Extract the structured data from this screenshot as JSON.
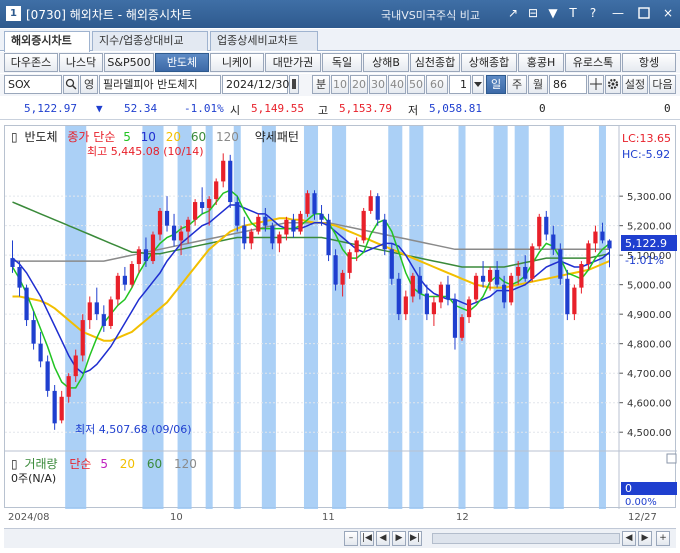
{
  "titlebar": {
    "app_number": "1",
    "title": "[0730] 해외차트 - 해외증시차트",
    "compare_label": "국내VS미국주식 비교",
    "buttons": [
      "↗",
      "⊟",
      "▼",
      "T",
      "?",
      "—",
      "×"
    ]
  },
  "tabs": [
    "해외증시차트",
    "지수/업종상대비교",
    "업종상세비교차트"
  ],
  "market_buttons": [
    {
      "label": "다우존스"
    },
    {
      "label": "나스닥"
    },
    {
      "label": "S&P500"
    },
    {
      "label": "반도체",
      "active": true
    },
    {
      "label": "니케이"
    },
    {
      "label": "대만가권"
    },
    {
      "label": "독일"
    },
    {
      "label": "상해B"
    },
    {
      "label": "심천종합"
    },
    {
      "label": "상해종합"
    },
    {
      "label": "홍콩H"
    },
    {
      "label": "유로스톡"
    },
    {
      "label": "항셍"
    }
  ],
  "controls": {
    "symbol": "SOX",
    "type_label": "영",
    "name": "필라델피아 반도체지",
    "date": "2024/12/30",
    "unit_button": "분",
    "intervals": [
      "10",
      "20",
      "30",
      "40",
      "50",
      "60"
    ],
    "count_value": "1",
    "periods": [
      {
        "label": "일",
        "active": true
      },
      {
        "label": "주"
      },
      {
        "label": "월"
      }
    ],
    "bars": "86",
    "settings_label": "설정",
    "next_label": "다음"
  },
  "quote": {
    "price": "5,122.97",
    "change_arrow": "▼",
    "change": "52.34",
    "change_pct": "-1.01%",
    "open_label": "시",
    "open": "5,149.55",
    "high_label": "고",
    "high": "5,153.79",
    "low_label": "저",
    "low": "5,058.81",
    "volume": "0",
    "amount": "0"
  },
  "colors": {
    "up": "#e8202a",
    "down": "#1f3fcf",
    "ma5": "#22c422",
    "ma10": "#1f2ed0",
    "ma20": "#f2bf00",
    "ma60": "#3a8a3a",
    "ma120": "#8a8a8a",
    "band": "#9cc8f4"
  },
  "legend": {
    "name": "반도체",
    "ma_label": "종가 단순",
    "ma": [
      "5",
      "10",
      "20",
      "60",
      "120"
    ],
    "pattern": "약세패턴"
  },
  "annotations": {
    "high_text": "최고 5,445.08 (10/14)",
    "low_text": "최저  4,507.68 (09/06)",
    "lc": "LC:13.65",
    "hc": "HC:-5.92",
    "last_price": "5,122.9",
    "last_pct": "-1.01%"
  },
  "volume_panel": {
    "title": "거래량",
    "ma_label": "단순",
    "ma": [
      "5",
      "20",
      "60",
      "120"
    ],
    "value_text": "0주(N/A)",
    "axis_value": "0",
    "axis_pct": "0.00%"
  },
  "chart_data": {
    "type": "candlestick",
    "yticks": [
      4500,
      4600,
      4700,
      4800,
      4900,
      5000,
      5100,
      5200,
      5300
    ],
    "ytick_labels": [
      "4,500.00",
      "4,600.00",
      "4,700.00",
      "4,800.00",
      "4,900.00",
      "5,000.00",
      "5,100.00",
      "5,200.00",
      "5,300.00"
    ],
    "ylim": [
      4460,
      5470
    ],
    "x_labels": [
      "2024/08",
      "10",
      "11",
      "12",
      "12/27"
    ],
    "high": 5445.08,
    "low": 4507.68,
    "last": 5122.97,
    "candles": [
      [
        5090,
        5150,
        5040,
        5060
      ],
      [
        5060,
        5080,
        4960,
        4990
      ],
      [
        4990,
        5000,
        4860,
        4880
      ],
      [
        4880,
        4910,
        4780,
        4800
      ],
      [
        4800,
        4840,
        4720,
        4740
      ],
      [
        4740,
        4760,
        4620,
        4640
      ],
      [
        4640,
        4660,
        4508,
        4530
      ],
      [
        4540,
        4640,
        4530,
        4620
      ],
      [
        4620,
        4700,
        4600,
        4690
      ],
      [
        4690,
        4780,
        4670,
        4760
      ],
      [
        4760,
        4900,
        4740,
        4880
      ],
      [
        4880,
        4960,
        4850,
        4940
      ],
      [
        4940,
        4990,
        4880,
        4900
      ],
      [
        4900,
        4930,
        4840,
        4860
      ],
      [
        4860,
        4960,
        4850,
        4950
      ],
      [
        4950,
        5040,
        4930,
        5030
      ],
      [
        5030,
        5060,
        4980,
        5000
      ],
      [
        5000,
        5080,
        4990,
        5070
      ],
      [
        5070,
        5130,
        5040,
        5120
      ],
      [
        5120,
        5160,
        5060,
        5080
      ],
      [
        5080,
        5180,
        5070,
        5170
      ],
      [
        5170,
        5260,
        5150,
        5250
      ],
      [
        5250,
        5300,
        5180,
        5200
      ],
      [
        5200,
        5240,
        5130,
        5150
      ],
      [
        5150,
        5200,
        5100,
        5180
      ],
      [
        5180,
        5230,
        5140,
        5220
      ],
      [
        5220,
        5290,
        5200,
        5280
      ],
      [
        5280,
        5330,
        5240,
        5260
      ],
      [
        5260,
        5300,
        5200,
        5290
      ],
      [
        5290,
        5360,
        5270,
        5350
      ],
      [
        5350,
        5445,
        5330,
        5420
      ],
      [
        5420,
        5440,
        5260,
        5280
      ],
      [
        5280,
        5300,
        5180,
        5200
      ],
      [
        5200,
        5230,
        5120,
        5140
      ],
      [
        5140,
        5190,
        5120,
        5180
      ],
      [
        5180,
        5240,
        5170,
        5230
      ],
      [
        5230,
        5260,
        5180,
        5200
      ],
      [
        5200,
        5210,
        5120,
        5140
      ],
      [
        5140,
        5180,
        5110,
        5170
      ],
      [
        5170,
        5230,
        5150,
        5220
      ],
      [
        5220,
        5240,
        5160,
        5180
      ],
      [
        5180,
        5250,
        5170,
        5240
      ],
      [
        5240,
        5320,
        5230,
        5310
      ],
      [
        5310,
        5320,
        5220,
        5240
      ],
      [
        5240,
        5270,
        5200,
        5220
      ],
      [
        5220,
        5240,
        5080,
        5100
      ],
      [
        5100,
        5120,
        4980,
        5000
      ],
      [
        5000,
        5050,
        4960,
        5040
      ],
      [
        5040,
        5120,
        5020,
        5110
      ],
      [
        5110,
        5160,
        5080,
        5150
      ],
      [
        5150,
        5260,
        5140,
        5250
      ],
      [
        5250,
        5320,
        5240,
        5300
      ],
      [
        5300,
        5310,
        5200,
        5220
      ],
      [
        5220,
        5240,
        5100,
        5120
      ],
      [
        5120,
        5140,
        5000,
        5020
      ],
      [
        5020,
        5040,
        4880,
        4900
      ],
      [
        4900,
        4980,
        4880,
        4960
      ],
      [
        4960,
        5040,
        4940,
        5030
      ],
      [
        5030,
        5060,
        4950,
        4970
      ],
      [
        4970,
        5000,
        4880,
        4900
      ],
      [
        4900,
        4960,
        4860,
        4940
      ],
      [
        4940,
        5010,
        4920,
        5000
      ],
      [
        5000,
        5030,
        4930,
        4950
      ],
      [
        4950,
        4970,
        4780,
        4820
      ],
      [
        4820,
        4900,
        4810,
        4890
      ],
      [
        4890,
        4960,
        4870,
        4950
      ],
      [
        4950,
        5040,
        4940,
        5030
      ],
      [
        5030,
        5080,
        4990,
        5010
      ],
      [
        5010,
        5060,
        4980,
        5050
      ],
      [
        5050,
        5080,
        4990,
        5000
      ],
      [
        5000,
        5030,
        4920,
        4940
      ],
      [
        4940,
        5040,
        4930,
        5030
      ],
      [
        5030,
        5080,
        5000,
        5060
      ],
      [
        5060,
        5100,
        5010,
        5020
      ],
      [
        5020,
        5140,
        5010,
        5130
      ],
      [
        5130,
        5240,
        5120,
        5230
      ],
      [
        5230,
        5250,
        5150,
        5170
      ],
      [
        5170,
        5200,
        5100,
        5120
      ],
      [
        5120,
        5140,
        5000,
        5020
      ],
      [
        5020,
        5050,
        4880,
        4900
      ],
      [
        4900,
        5000,
        4880,
        4990
      ],
      [
        4990,
        5080,
        4970,
        5070
      ],
      [
        5070,
        5150,
        5050,
        5140
      ],
      [
        5140,
        5200,
        5110,
        5180
      ],
      [
        5180,
        5210,
        5140,
        5150
      ],
      [
        5149.55,
        5153.79,
        5058.81,
        5122.97
      ]
    ],
    "ma5": [
      5060,
      5020,
      4970,
      4910,
      4850,
      4790,
      4720,
      4670,
      4650,
      4650,
      4690,
      4760,
      4820,
      4870,
      4900,
      4930,
      4950,
      4990,
      5040,
      5080,
      5110,
      5140,
      5160,
      5170,
      5190,
      5200,
      5220,
      5240,
      5250,
      5280,
      5310,
      5320,
      5300,
      5250,
      5210,
      5190,
      5190,
      5190,
      5190,
      5190,
      5190,
      5200,
      5220,
      5240,
      5240,
      5210,
      5170,
      5120,
      5090,
      5090,
      5110,
      5170,
      5210,
      5220,
      5180,
      5110,
      5040,
      4990,
      4970,
      4960,
      4960,
      4960,
      4960,
      4930,
      4920,
      4910,
      4930,
      4960,
      5010,
      5030,
      5010,
      5000,
      5010,
      5030,
      5070,
      5110,
      5140,
      5130,
      5090,
      5040,
      5030,
      5020,
      5050,
      5090,
      5120,
      5140
    ],
    "ma10": [
      5090,
      5070,
      5040,
      5000,
      4960,
      4910,
      4860,
      4810,
      4760,
      4720,
      4700,
      4710,
      4730,
      4760,
      4790,
      4830,
      4870,
      4910,
      4950,
      4980,
      5010,
      5040,
      5080,
      5110,
      5140,
      5160,
      5180,
      5200,
      5210,
      5230,
      5250,
      5270,
      5270,
      5260,
      5250,
      5240,
      5240,
      5220,
      5200,
      5190,
      5190,
      5190,
      5200,
      5210,
      5210,
      5200,
      5180,
      5160,
      5140,
      5120,
      5110,
      5120,
      5130,
      5140,
      5140,
      5130,
      5100,
      5060,
      5020,
      4990,
      4970,
      4960,
      4950,
      4950,
      4940,
      4930,
      4940,
      4950,
      4960,
      4980,
      4980,
      4980,
      4990,
      5000,
      5020,
      5040,
      5060,
      5070,
      5080,
      5070,
      5060,
      5060,
      5070,
      5080,
      5090,
      5110
    ],
    "ma20": [
      4960,
      4960,
      4955,
      4950,
      4945,
      4935,
      4920,
      4900,
      4880,
      4860,
      4840,
      4830,
      4820,
      4810,
      4810,
      4820,
      4830,
      4840,
      4860,
      4880,
      4900,
      4920,
      4940,
      4970,
      5000,
      5030,
      5060,
      5090,
      5120,
      5140,
      5160,
      5180,
      5190,
      5200,
      5205,
      5210,
      5215,
      5220,
      5225,
      5225,
      5220,
      5220,
      5215,
      5210,
      5210,
      5205,
      5200,
      5190,
      5180,
      5170,
      5160,
      5150,
      5140,
      5130,
      5120,
      5110,
      5100,
      5090,
      5080,
      5070,
      5060,
      5050,
      5040,
      5030,
      5020,
      5010,
      5000,
      4995,
      4990,
      4990,
      4990,
      4995,
      5000,
      5005,
      5010,
      5015,
      5020,
      5025,
      5030,
      5035,
      5040,
      5045,
      5050,
      5060,
      5070,
      5080
    ],
    "ma60": [
      5280,
      5270,
      5260,
      5250,
      5240,
      5230,
      5220,
      5210,
      5200,
      5190,
      5180,
      5170,
      5160,
      5150,
      5140,
      5130,
      5120,
      5110,
      5110,
      5105,
      5105,
      5105,
      5110,
      5115,
      5120,
      5125,
      5130,
      5135,
      5140,
      5145,
      5150,
      5155,
      5160,
      5160,
      5160,
      5160,
      5160,
      5160,
      5160,
      5160,
      5160,
      5160,
      5160,
      5160,
      5160,
      5155,
      5150,
      5145,
      5140,
      5135,
      5130,
      5125,
      5120,
      5115,
      5110,
      5105,
      5100,
      5095,
      5090,
      5085,
      5080,
      5075,
      5070,
      5065,
      5060,
      5060,
      5060,
      5060,
      5060,
      5060,
      5060,
      5065,
      5070,
      5075,
      5080,
      5085,
      5090,
      5090,
      5090,
      5090,
      5090,
      5090,
      5090,
      5095,
      5100,
      5105
    ],
    "ma120": [
      5080,
      5080,
      5080,
      5080,
      5080,
      5080,
      5080,
      5080,
      5080,
      5080,
      5080,
      5080,
      5080,
      5080,
      5085,
      5090,
      5095,
      5100,
      5105,
      5110,
      5115,
      5120,
      5125,
      5130,
      5135,
      5140,
      5145,
      5150,
      5155,
      5160,
      5165,
      5170,
      5175,
      5180,
      5185,
      5190,
      5195,
      5200,
      5205,
      5210,
      5210,
      5210,
      5210,
      5210,
      5210,
      5210,
      5205,
      5200,
      5195,
      5190,
      5185,
      5180,
      5175,
      5170,
      5165,
      5160,
      5155,
      5150,
      5145,
      5140,
      5135,
      5130,
      5125,
      5120,
      5120,
      5120,
      5120,
      5120,
      5120,
      5120,
      5120,
      5120,
      5120,
      5120,
      5120,
      5120,
      5120,
      5120,
      5120,
      5120,
      5120,
      5120,
      5120,
      5120,
      5120,
      5120
    ],
    "bands": [
      [
        8,
        10
      ],
      [
        19,
        21
      ],
      [
        24,
        25
      ],
      [
        28,
        28
      ],
      [
        32,
        32
      ],
      [
        36,
        37
      ],
      [
        42,
        43
      ],
      [
        46,
        47
      ],
      [
        54,
        55
      ],
      [
        57,
        58
      ],
      [
        64,
        64
      ],
      [
        69,
        70
      ],
      [
        72,
        73
      ],
      [
        77,
        78
      ],
      [
        84,
        84
      ]
    ]
  }
}
